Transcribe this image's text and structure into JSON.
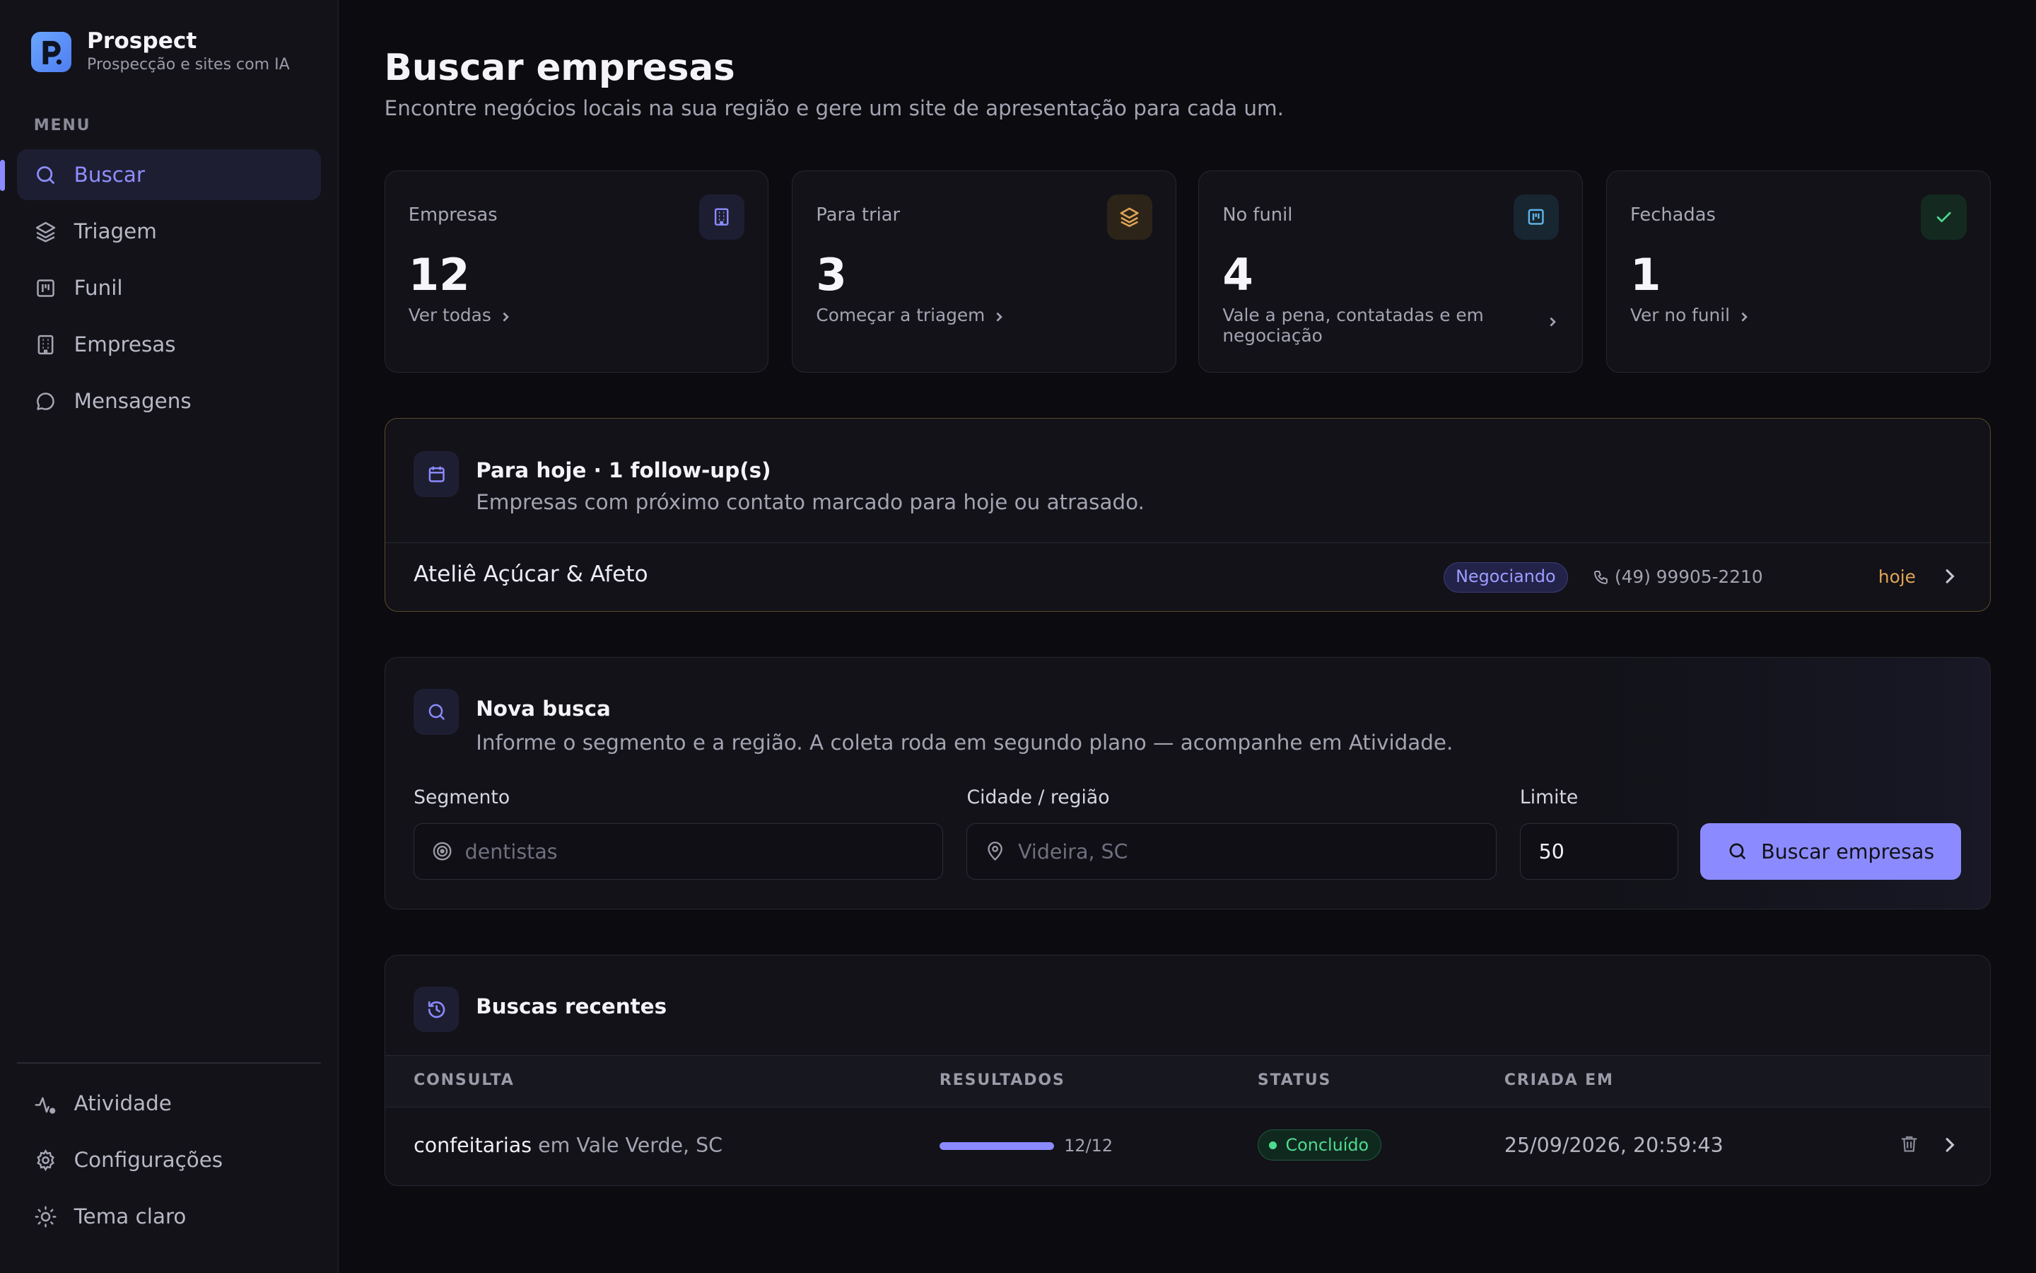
{
  "app": {
    "name": "Prospect",
    "tagline": "Prospecção e sites com IA",
    "logo_letter": "P"
  },
  "sidebar": {
    "menu_label": "MENU",
    "items": [
      {
        "label": "Buscar",
        "icon": "search-icon",
        "active": true
      },
      {
        "label": "Triagem",
        "icon": "layers-icon",
        "active": false
      },
      {
        "label": "Funil",
        "icon": "kanban-icon",
        "active": false
      },
      {
        "label": "Empresas",
        "icon": "building-icon",
        "active": false
      },
      {
        "label": "Mensagens",
        "icon": "message-icon",
        "active": false
      }
    ],
    "bottom_items": [
      {
        "label": "Atividade",
        "icon": "activity-icon"
      },
      {
        "label": "Configurações",
        "icon": "gear-icon"
      },
      {
        "label": "Tema claro",
        "icon": "sun-icon"
      }
    ]
  },
  "page": {
    "title": "Buscar empresas",
    "subtitle": "Encontre negócios locais na sua região e gere um site de apresentação para cada um."
  },
  "stats": [
    {
      "label": "Empresas",
      "value": "12",
      "link": "Ver todas",
      "icon": "building-icon",
      "color": "#8b8bff"
    },
    {
      "label": "Para triar",
      "value": "3",
      "link": "Começar a triagem",
      "icon": "layers-icon",
      "color": "#e0a457"
    },
    {
      "label": "No funil",
      "value": "4",
      "link": "Vale a pena, contatadas e em negociação",
      "icon": "kanban-icon",
      "color": "#5fb4e8"
    },
    {
      "label": "Fechadas",
      "value": "1",
      "link": "Ver no funil",
      "icon": "check-icon",
      "color": "#4ddc8f"
    }
  ],
  "today": {
    "title": "Para hoje · 1 follow-up(s)",
    "subtitle": "Empresas com próximo contato marcado para hoje ou atrasado.",
    "items": [
      {
        "name": "Ateliê Açúcar & Afeto",
        "status": "Negociando",
        "phone": "(49) 99905-2210",
        "when": "hoje"
      }
    ]
  },
  "search": {
    "title": "Nova busca",
    "subtitle": "Informe o segmento e a região. A coleta roda em segundo plano — acompanhe em Atividade.",
    "segment_label": "Segmento",
    "segment_placeholder": "dentistas",
    "city_label": "Cidade / região",
    "city_placeholder": "Videira, SC",
    "limit_label": "Limite",
    "limit_value": "50",
    "button_label": "Buscar empresas"
  },
  "recent": {
    "title": "Buscas recentes",
    "columns": [
      "CONSULTA",
      "RESULTADOS",
      "STATUS",
      "CRIADA EM"
    ],
    "rows": [
      {
        "segment": "confeitarias",
        "location_text": "em Vale Verde, SC",
        "results": "12/12",
        "progress": 1.0,
        "status": "Concluído",
        "created": "25/09/2026, 20:59:43"
      }
    ]
  }
}
